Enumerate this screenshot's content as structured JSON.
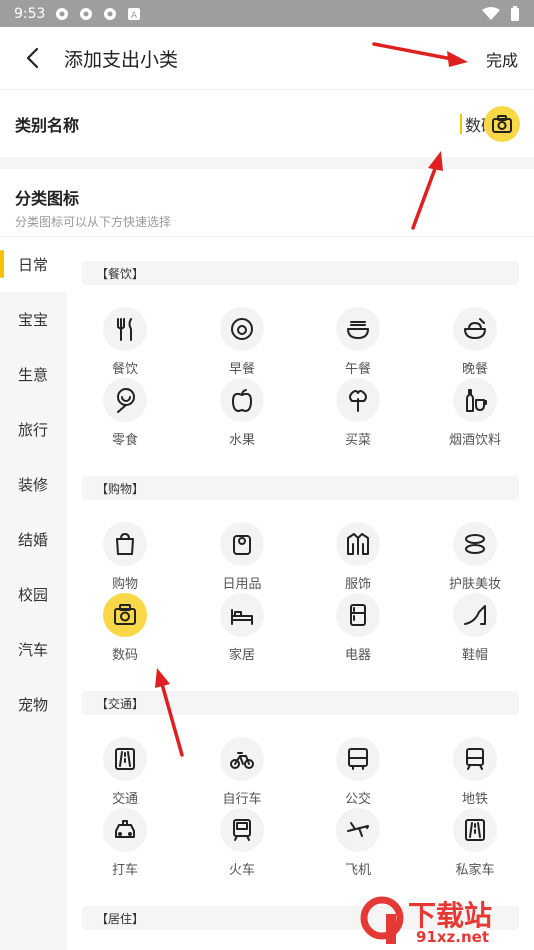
{
  "status": {
    "time": "9:53"
  },
  "header": {
    "title": "添加支出小类",
    "done_label": "完成"
  },
  "name_row": {
    "label": "类别名称",
    "value": "数码"
  },
  "icon_section": {
    "title": "分类图标",
    "subtitle": "分类图标可以从下方快速选择"
  },
  "sidebar": {
    "items": [
      "日常",
      "宝宝",
      "生意",
      "旅行",
      "装修",
      "结婚",
      "校园",
      "汽车",
      "宠物"
    ],
    "active": 0
  },
  "groups": [
    {
      "title": "【餐饮】",
      "items": [
        {
          "label": "餐饮",
          "icon": "fork-knife-icon"
        },
        {
          "label": "早餐",
          "icon": "egg-icon"
        },
        {
          "label": "午餐",
          "icon": "noodle-bowl-icon"
        },
        {
          "label": "晚餐",
          "icon": "rice-bowl-icon"
        },
        {
          "label": "零食",
          "icon": "lollipop-icon"
        },
        {
          "label": "水果",
          "icon": "apple-icon"
        },
        {
          "label": "买菜",
          "icon": "vegetable-icon"
        },
        {
          "label": "烟酒饮料",
          "icon": "bottle-cup-icon"
        }
      ]
    },
    {
      "title": "【购物】",
      "items": [
        {
          "label": "购物",
          "icon": "shopping-bag-icon"
        },
        {
          "label": "日用品",
          "icon": "tissue-roll-icon"
        },
        {
          "label": "服饰",
          "icon": "jacket-icon"
        },
        {
          "label": "护肤美妆",
          "icon": "cosmetics-icon"
        },
        {
          "label": "数码",
          "icon": "camera-icon",
          "selected": true
        },
        {
          "label": "家居",
          "icon": "bed-icon"
        },
        {
          "label": "电器",
          "icon": "fridge-icon"
        },
        {
          "label": "鞋帽",
          "icon": "high-heel-icon"
        }
      ]
    },
    {
      "title": "【交通】",
      "items": [
        {
          "label": "交通",
          "icon": "road-icon"
        },
        {
          "label": "自行车",
          "icon": "bicycle-icon"
        },
        {
          "label": "公交",
          "icon": "bus-icon"
        },
        {
          "label": "地铁",
          "icon": "subway-icon"
        },
        {
          "label": "打车",
          "icon": "taxi-icon"
        },
        {
          "label": "火车",
          "icon": "train-icon"
        },
        {
          "label": "飞机",
          "icon": "airplane-icon"
        },
        {
          "label": "私家车",
          "icon": "car-road-icon"
        }
      ]
    },
    {
      "title": "【居住】",
      "items": []
    }
  ],
  "watermark": {
    "text_big": "下载站",
    "text_small": "91xz.net"
  },
  "colors": {
    "accent": "#f9d848",
    "arrow": "#e02020"
  }
}
